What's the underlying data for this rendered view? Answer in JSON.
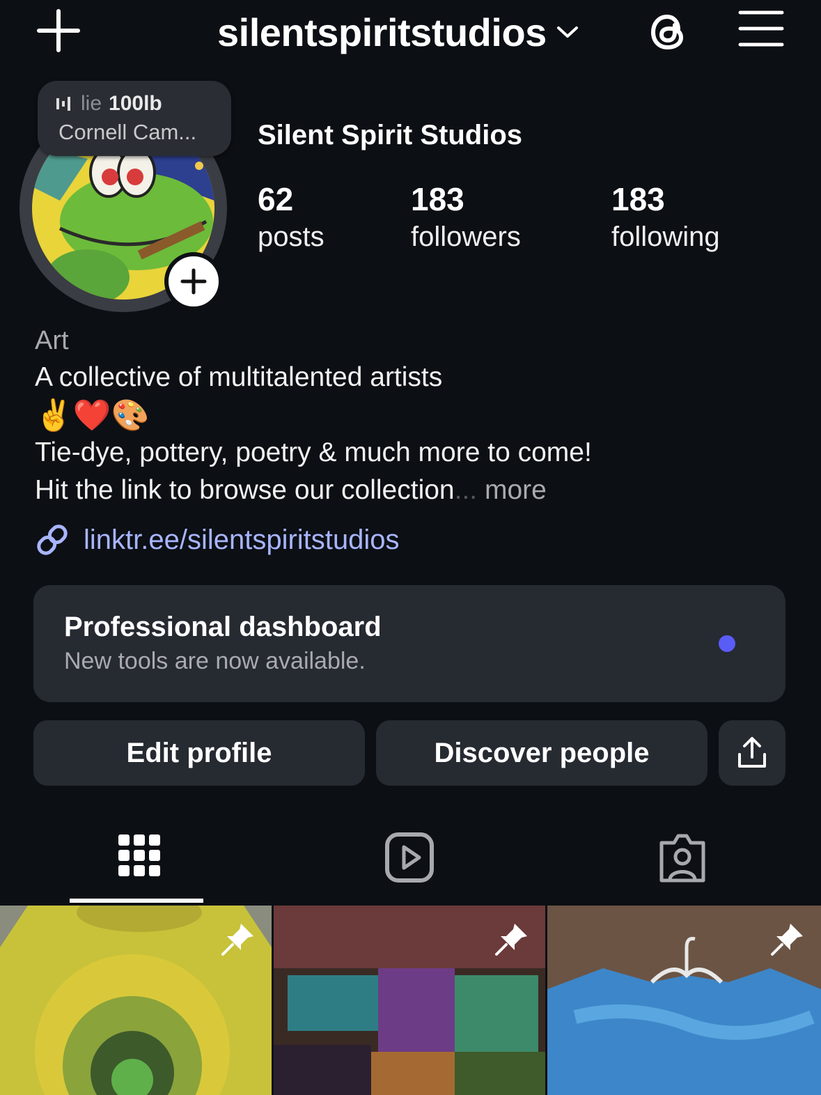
{
  "header": {
    "username": "silentspiritstudios",
    "icons": [
      "plus-icon",
      "chevron-down-icon",
      "threads-icon",
      "menu-icon"
    ]
  },
  "note": {
    "line1_a": "lie",
    "line1_b": "100lb",
    "line2": "Cornell Cam..."
  },
  "profile": {
    "display_name": "Silent Spirit Studios",
    "stats": [
      {
        "value": "62",
        "label": "posts"
      },
      {
        "value": "183",
        "label": "followers"
      },
      {
        "value": "183",
        "label": "following"
      }
    ]
  },
  "bio": {
    "category": "Art",
    "line1": "A collective of multitalented artists",
    "emojis": "✌️❤️🎨",
    "line2": "Tie-dye, pottery, poetry & much more to come!",
    "line3": "Hit the link to browse our collection",
    "ellipsis": "...",
    "more": "more",
    "link": "linktr.ee/silentspiritstudios"
  },
  "dashboard": {
    "title": "Professional dashboard",
    "subtitle": "New tools are now available.",
    "dot_color": "#5a5cf6"
  },
  "buttons": {
    "edit": "Edit profile",
    "discover": "Discover people"
  },
  "tabs": [
    {
      "name": "grid",
      "icon": "grid-icon",
      "active": true
    },
    {
      "name": "reels",
      "icon": "reels-icon",
      "active": false
    },
    {
      "name": "tagged",
      "icon": "tagged-icon",
      "active": false
    }
  ],
  "posts": [
    {
      "pinned": true,
      "alt": "yellow tie-dye shirt"
    },
    {
      "pinned": true,
      "alt": "goosebumps collage"
    },
    {
      "pinned": true,
      "alt": "blue tie-dye shirt"
    }
  ],
  "colors": {
    "background": "#0c0f14",
    "card": "#262a31",
    "link": "#a8b5ff"
  }
}
